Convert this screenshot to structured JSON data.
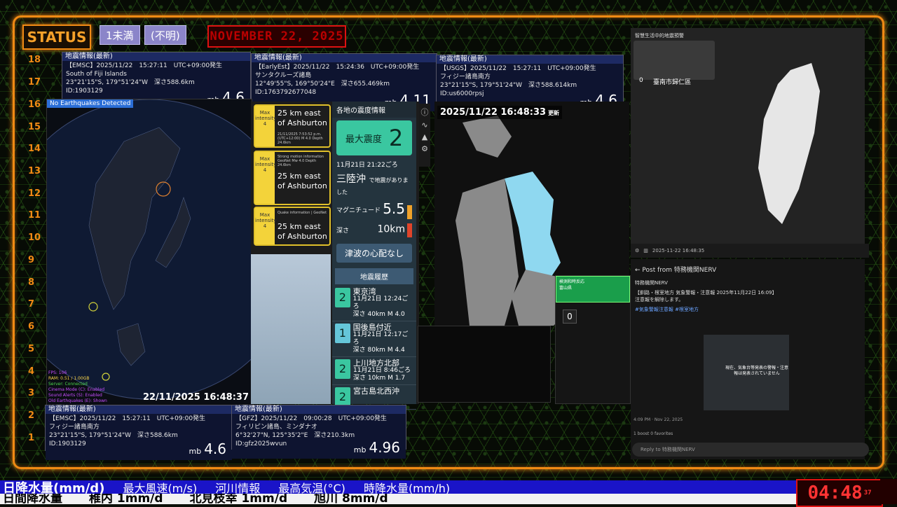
{
  "header": {
    "status_label": "STATUS",
    "pill1": "1未満",
    "pill2": "(不明)",
    "date": "NOVEMBER 22, 2025"
  },
  "scale": [
    "18",
    "17",
    "16",
    "15",
    "14",
    "13",
    "12",
    "11",
    "10",
    "9",
    "8",
    "7",
    "6",
    "5",
    "4",
    "3",
    "2",
    "1"
  ],
  "info_top": [
    {
      "header": "地震情報(最新)",
      "source": "【EMSC】2025/11/22　15:27:11　UTC+09:00発生",
      "place": "South of Fiji Islands",
      "coords": "23°21'15\"S, 179°51'24\"W　深さ588.6km",
      "id": "ID:1903129",
      "mb": "mb",
      "mag": "4.6"
    },
    {
      "header": "地震情報(最新)",
      "source": "【EarlyEst】2025/11/22　15:24:36　UTC+09:00発生",
      "place": "サンタクルーズ諸島",
      "coords": "12°49'55\"S, 169°50'24\"E　深さ655.469km",
      "id": "ID:1763792677048",
      "mb": "mb",
      "mag": "4.11"
    },
    {
      "header": "地震情報(最新)",
      "source": "【USGS】2025/11/22　15:27:11　UTC+09:00発生",
      "place": "フィジー諸島南方",
      "coords": "23°21'15\"S, 179°51'24\"W　深さ588.614km",
      "id": "ID:us6000rpsj",
      "mb": "mb",
      "mag": "4.6"
    }
  ],
  "info_bottom": [
    {
      "header": "地震情報(最新)",
      "source": "【EMSC】2025/11/22　15:27:11　UTC+09:00発生",
      "place": "フィジー諸島南方",
      "coords": "23°21'15\"S, 179°51'24\"W　深さ588.6km",
      "id": "ID:1903129",
      "mb": "mb",
      "mag": "4.6"
    },
    {
      "header": "地震情報(最新)",
      "source": "【GFZ】2025/11/22　09:00:28　UTC+09:00発生",
      "place": "フィリピン諸島、ミンダナオ",
      "coords": "6°32'27\"N, 125°35'2\"E　深さ210.3km",
      "id": "ID:gfz2025wvun",
      "mb": "mb",
      "mag": "4.96"
    }
  ],
  "globe": {
    "no_eq": "No Earthquakes Detected",
    "clock": "22/11/2025 16:48:37",
    "stats": [
      "FPS: 106",
      "RAM: 0.51 / 1.00GB",
      "Server: Connected",
      "Cinema Mode (C): Enabled",
      "Sound Alerts (S): Enabled",
      "Old Earthquakes (E): Shown"
    ]
  },
  "yellow_cards": [
    {
      "lvl": "Max intensity 4",
      "title": "25 km east of Ashburton",
      "sub": "21/11/2025 7:53:52 p.m. (UTC+12:00)  M 4.0  Depth 24.6km"
    },
    {
      "lvl": "Max intensity 4",
      "title": "25 km east of Ashburton",
      "sub": "Strong motion information GeoNet  Mw 4.0  Depth 24.6km"
    },
    {
      "lvl": "Max intensity 4",
      "title": "25 km east of Ashburton",
      "sub": "Quake information | GeoNet"
    }
  ],
  "quake": {
    "header": "各地の震度情報",
    "max_label": "最大震度",
    "max_val": "2",
    "time": "11月21日 21:22ごろ",
    "place": "三陸沖",
    "place_suffix": "で地震がありました",
    "mag_label": "マグニチュード",
    "mag": "5.5",
    "depth_label": "深さ",
    "depth": "10km",
    "tsunami": "津波の心配なし",
    "history_title": "地震履歴",
    "history": [
      {
        "int": "2",
        "place": "東京湾",
        "time": "11月21日 12:24ごろ",
        "depth": "深さ 40km",
        "mag": "M 4.0"
      },
      {
        "int": "1",
        "place": "国後島付近",
        "time": "11月21日 12:17ごろ",
        "depth": "深さ 80km",
        "mag": "M 4.4"
      },
      {
        "int": "2",
        "place": "上川地方北部",
        "time": "11月21日 8:46ごろ",
        "depth": "深さ 10km",
        "mag": "M 1.7"
      },
      {
        "int": "2",
        "place": "宮古島北西沖",
        "time": "",
        "depth": "",
        "mag": ""
      }
    ]
  },
  "japan": {
    "timestamp": "2025/11/22 16:48:33",
    "suffix": "更新"
  },
  "detect": {
    "title": "検測和時反応",
    "sub": "富山県",
    "zero": "0"
  },
  "taiwan": {
    "title": "智慧生活中的地震預警",
    "loc": "臺南市歸仁區",
    "zero": "0",
    "toolbar_time": "2025-11-22 16:48:35"
  },
  "post": {
    "back": "Post from 特務機関NERV",
    "author": "特務機関NERV",
    "text1": "【釧路・根室地方 気象警報・注意報 2025年11月22日 16:09】",
    "text2": "注意報を解除します。",
    "tag": "#気象警報注意報 #根室地方",
    "img_caption": "現在、気象台等発表の警報・注意報は発表されていません",
    "meta": "4:09 PM · Nov 22, 2025",
    "likes": "1 boost  0 favorites",
    "reply": "Reply to 特務機関NERV"
  },
  "ticker": {
    "line1": [
      "日降水量(mm/d)",
      "最大風速(m/s)",
      "河川情報",
      "最高気温(°C)",
      "時降水量(mm/h)"
    ],
    "line2": [
      "日間降水量",
      "稚内 1mm/d",
      "北見枝幸 1mm/d",
      "旭川 8mm/d"
    ]
  },
  "clock": {
    "time": "04:48",
    "sec": "37"
  }
}
